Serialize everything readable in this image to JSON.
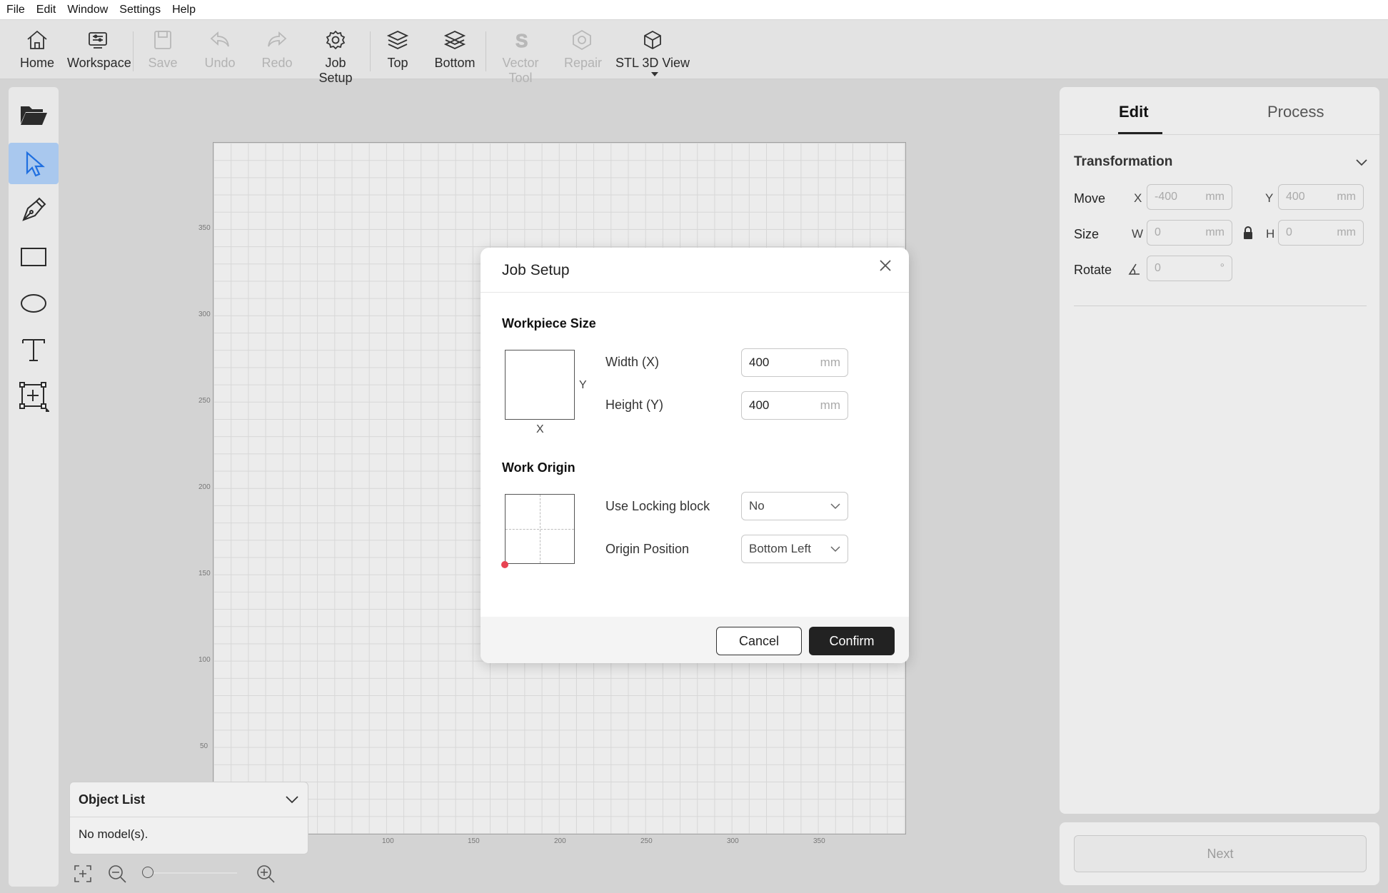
{
  "menu": [
    "File",
    "Edit",
    "Window",
    "Settings",
    "Help"
  ],
  "toolbar": {
    "home": "Home",
    "workspace": "Workspace",
    "save": "Save",
    "undo": "Undo",
    "redo": "Redo",
    "job_setup": "Job Setup",
    "top": "Top",
    "bottom": "Bottom",
    "vector_tool": "Vector Tool",
    "repair": "Repair",
    "stl_view": "STL 3D View"
  },
  "canvas": {
    "y_ticks": [
      "350",
      "300",
      "250",
      "200",
      "150",
      "100",
      "50"
    ],
    "x_ticks": [
      "100",
      "150",
      "200",
      "250",
      "300",
      "350"
    ]
  },
  "object_list": {
    "title": "Object List",
    "empty_text": "No model(s)."
  },
  "right_panel": {
    "tab_edit": "Edit",
    "tab_process": "Process",
    "section_title": "Transformation",
    "move_label": "Move",
    "size_label": "Size",
    "rotate_label": "Rotate",
    "x_axis": "X",
    "y_axis": "Y",
    "w_axis": "W",
    "h_axis": "H",
    "move_x": "-400",
    "move_y": "400",
    "size_w": "0",
    "size_h": "0",
    "rotate": "0",
    "unit_mm": "mm",
    "unit_deg": "°",
    "next": "Next"
  },
  "dialog": {
    "title": "Job Setup",
    "workpiece_section": "Workpiece Size",
    "width_label": "Width (X)",
    "height_label": "Height (Y)",
    "width_value": "400",
    "height_value": "400",
    "unit": "mm",
    "diagram_x": "X",
    "diagram_y": "Y",
    "origin_section": "Work Origin",
    "locking_label": "Use Locking block",
    "locking_value": "No",
    "origin_label": "Origin Position",
    "origin_value": "Bottom Left",
    "cancel": "Cancel",
    "confirm": "Confirm"
  }
}
